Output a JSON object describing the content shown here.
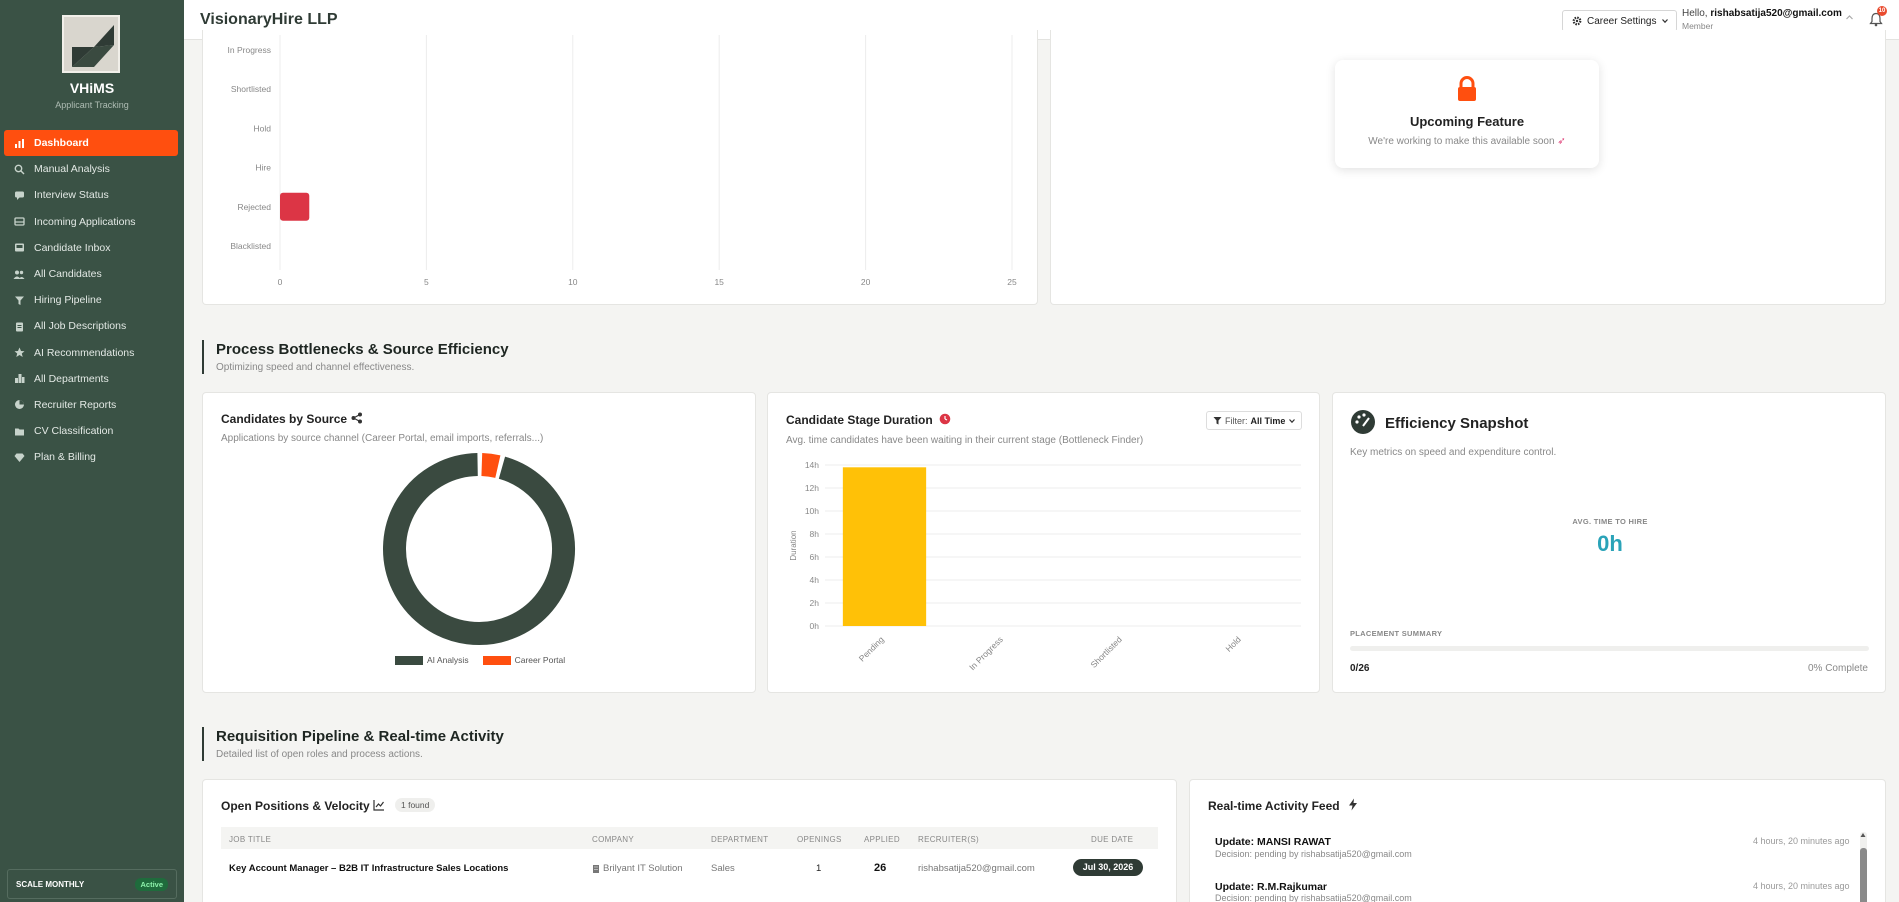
{
  "sidebar": {
    "brand": "VHiMS",
    "brand_sub": "Applicant Tracking",
    "items": [
      {
        "label": "Dashboard",
        "icon": "chart-icon",
        "active": true
      },
      {
        "label": "Manual Analysis",
        "icon": "search-icon"
      },
      {
        "label": "Interview Status",
        "icon": "chat-icon"
      },
      {
        "label": "Incoming Applications",
        "icon": "inbox-icon"
      },
      {
        "label": "Candidate Inbox",
        "icon": "tray-icon"
      },
      {
        "label": "All Candidates",
        "icon": "users-icon"
      },
      {
        "label": "Hiring Pipeline",
        "icon": "filter-icon"
      },
      {
        "label": "All Job Descriptions",
        "icon": "clipboard-icon"
      },
      {
        "label": "AI Recommendations",
        "icon": "star-icon"
      },
      {
        "label": "All Departments",
        "icon": "building-icon"
      },
      {
        "label": "Recruiter Reports",
        "icon": "pie-icon"
      },
      {
        "label": "CV Classification",
        "icon": "folder-icon"
      },
      {
        "label": "Plan & Billing",
        "icon": "gem-icon"
      }
    ],
    "plan": {
      "label": "SCALE MONTHLY",
      "status": "Active"
    }
  },
  "header": {
    "company": "VisionaryHire LLP",
    "career_settings": "Career Settings",
    "hello_prefix": "Hello,",
    "email": "rishabsatija520@gmail.com",
    "role": "Member",
    "notifications": "10"
  },
  "status_chart": {
    "chart_data": {
      "type": "bar",
      "orientation": "horizontal",
      "categories": [
        "In Progress",
        "Shortlisted",
        "Hold",
        "Hire",
        "Rejected",
        "Blacklisted"
      ],
      "values": [
        0,
        0,
        0,
        0,
        1,
        0
      ],
      "xlim": [
        0,
        25
      ],
      "x_ticks": [
        "0",
        "5",
        "10",
        "15",
        "20",
        "25"
      ],
      "bar_color": "#dc3545"
    }
  },
  "upcoming": {
    "title": "Upcoming Feature",
    "subtitle": "We're working to make this available soon"
  },
  "section1": {
    "title": "Process Bottlenecks & Source Efficiency",
    "subtitle": "Optimizing speed and channel effectiveness."
  },
  "source_card": {
    "title": "Candidates by Source",
    "subtitle": "Applications by source channel (Career Portal, email imports, referrals...)",
    "chart_data": {
      "type": "pie",
      "donut": true,
      "labels": [
        "AI Analysis",
        "Career Portal"
      ],
      "values": [
        25,
        1
      ],
      "colors": [
        "#3a4a40",
        "#ff4f0f"
      ]
    }
  },
  "duration_card": {
    "title": "Candidate Stage Duration",
    "subtitle": "Avg. time candidates have been waiting in their current stage (Bottleneck Finder)",
    "filter_label": "Filter:",
    "filter_value": "All Time",
    "chart_data": {
      "type": "bar",
      "categories": [
        "Pending",
        "In Progress",
        "Shortlisted",
        "Hold"
      ],
      "values": [
        13.8,
        0,
        0,
        0
      ],
      "ylabel": "Duration",
      "ylim": [
        0,
        14
      ],
      "y_ticks": [
        "0h",
        "2h",
        "4h",
        "6h",
        "8h",
        "10h",
        "12h",
        "14h"
      ],
      "bar_color": "#ffc107"
    }
  },
  "efficiency": {
    "title": "Efficiency Snapshot",
    "subtitle": "Key metrics on speed and expenditure control.",
    "avg_label": "AVG. TIME TO HIRE",
    "avg_value": "0h",
    "placement_label": "PLACEMENT SUMMARY",
    "placement_value": "0/26",
    "placement_pct": "0% Complete",
    "progress": 0
  },
  "section2": {
    "title": "Requisition Pipeline & Real-time Activity",
    "subtitle": "Detailed list of open roles and process actions."
  },
  "positions": {
    "title": "Open Positions & Velocity",
    "found": "1 found",
    "columns": [
      "JOB TITLE",
      "COMPANY",
      "DEPARTMENT",
      "OPENINGS",
      "APPLIED",
      "RECRUITER(S)",
      "DUE DATE"
    ],
    "rows": [
      {
        "title": "Key Account Manager – B2B IT Infrastructure Sales Locations",
        "company": "Brilyant IT Solution",
        "department": "Sales",
        "openings": "1",
        "applied": "26",
        "recruiter": "rishabsatija520@gmail.com",
        "due": "Jul 30, 2026"
      }
    ]
  },
  "feed": {
    "title": "Real-time Activity Feed",
    "items": [
      {
        "title": "Update: MANSI RAWAT",
        "detail": "Decision: pending by rishabsatija520@gmail.com",
        "time": "4 hours, 20 minutes ago"
      },
      {
        "title": "Update: R.M.Rajkumar",
        "detail": "Decision: pending by rishabsatija520@gmail.com",
        "time": "4 hours, 20 minutes ago"
      }
    ]
  }
}
